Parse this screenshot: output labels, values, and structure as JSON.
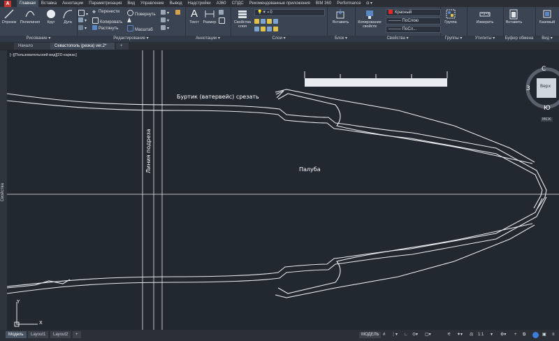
{
  "ribbon_tabs": [
    "Главная",
    "Вставка",
    "Аннотации",
    "Параметризация",
    "Вид",
    "Управление",
    "Вывод",
    "Надстройки",
    "A360",
    "СПДС",
    "Рекомендованные приложения",
    "BIM 360",
    "Performance"
  ],
  "active_tab": "Главная",
  "draw_panel": {
    "title": "Рисование",
    "polyline": "Отрезок",
    "pline": "Полилиния",
    "circle": "Круг",
    "arc": "Дуга"
  },
  "modify_panel": {
    "title": "Редактирование",
    "move": "Перенести",
    "rotate": "Повернуть",
    "copy": "Копировать",
    "mirror": "",
    "stretch": "Растянуть",
    "scale": "Масштаб"
  },
  "annot_panel": {
    "title": "Аннотации",
    "text": "Текст",
    "dim": "Размер"
  },
  "layers_panel": {
    "title": "Слои",
    "props": "Свойства слоя",
    "layer_value": "0"
  },
  "block_panel": {
    "title": "Блок",
    "insert": "Вставить"
  },
  "props_panel": {
    "title": "Свойства",
    "match": "Копирование свойств",
    "color": "Красный",
    "ltype": "ПоСлою",
    "lweight": "ПоСл..."
  },
  "groups_panel": {
    "title": "Группы",
    "group": "Группа"
  },
  "util_panel": {
    "title": "Утилиты",
    "measure": "Измерить"
  },
  "clip_panel": {
    "title": "Буфер обмена",
    "paste": "Вставить"
  },
  "view_panel": {
    "title": "Вид",
    "base": "Базовый"
  },
  "doc_tabs": [
    "Начало",
    "Севастополь (резка) ver.2*"
  ],
  "view_label": "[–][Пользовательский вид][2D-каркас]",
  "palette_label": "Свойства",
  "drawing": {
    "label_waterline": "Буртик (ватервейс) срезать",
    "label_cut": "Линия подреза",
    "label_deck": "Палуба"
  },
  "viewcube": {
    "n": "С",
    "s": "Ю",
    "w": "З",
    "face": "Верх",
    "wcs": "МСК"
  },
  "layout_tabs": [
    "Модель",
    "Layout1",
    "Layout2"
  ],
  "status": {
    "model": "МОДЕЛЬ",
    "scale": "1:1"
  },
  "ucs": {
    "y": "Y",
    "x": "X"
  },
  "colors": {
    "accent": "#c7332f",
    "ribbon": "#3b4453",
    "canvas": "#212830",
    "line": "#ffffff"
  }
}
